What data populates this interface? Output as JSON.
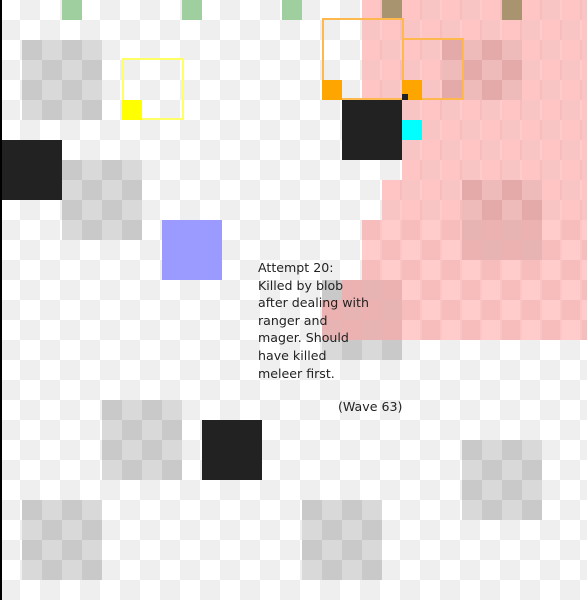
{
  "annotation": {
    "note": "Attempt 20:\nKilled by blob\nafter dealing with\nranger and\nmager. Should\nhave killed\nmeleer first.",
    "wave": "(Wave 63)"
  },
  "colors": {
    "danger_zone": "#ff8c8c",
    "monster_blob": "#ffa500",
    "monster_mager": "#ffa500",
    "player": "#ffff00",
    "ally_marker": "#00ffff",
    "blue_tile": "#9b9bff",
    "olive_tile": "#a89570",
    "green_tile": "#9fcf9f",
    "black_tile": "#222222",
    "pillar": "#cfcfcf"
  },
  "tiles": {
    "pillars": [
      "pillar-1",
      "pillar-2",
      "pillar-3",
      "pillar-4",
      "pillar-5",
      "pillar-6",
      "pillar-7",
      "pillar-8",
      "pillar-9"
    ],
    "icons": {
      "player": "yellow-square",
      "ally": "cyan-square",
      "monsters": "orange-square"
    }
  }
}
